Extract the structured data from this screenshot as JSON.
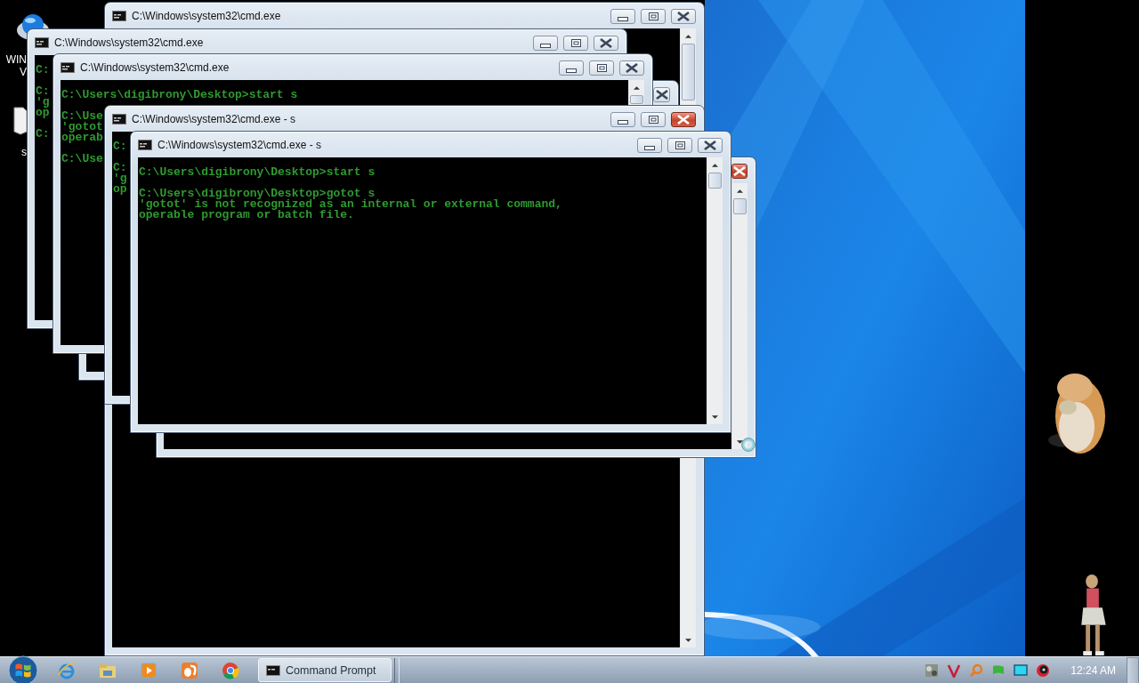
{
  "desktop_icons": [
    {
      "label_lines": [
        "WIN",
        "V"
      ]
    },
    {
      "label_lines": [
        "s"
      ]
    }
  ],
  "windows": [
    {
      "title": "C:\\Windows\\system32\\cmd.exe",
      "controls": [
        {
          "kind": "minimize"
        },
        {
          "kind": "maximize"
        },
        {
          "kind": "close"
        }
      ],
      "close_highlighted": false,
      "scrollbar": [
        {
          "kind": "up"
        },
        {
          "kind": "thumb"
        },
        {
          "kind": "down"
        }
      ]
    },
    {
      "title": "C:\\Windows\\system32\\cmd.exe",
      "controls": [
        {
          "kind": "minimize"
        },
        {
          "kind": "maximize"
        },
        {
          "kind": "close"
        }
      ],
      "close_highlighted": false,
      "output": [
        [
          "C:"
        ],
        [
          "C:",
          "'g",
          "op"
        ],
        [
          "C:"
        ]
      ]
    },
    {
      "controls": [
        {
          "kind": "close"
        }
      ],
      "close_highlighted": false
    },
    {
      "title": "C:\\Windows\\system32\\cmd.exe",
      "controls": [
        {
          "kind": "minimize"
        },
        {
          "kind": "maximize"
        },
        {
          "kind": "close"
        }
      ],
      "close_highlighted": false,
      "scrollbar": [
        {
          "kind": "up"
        },
        {
          "kind": "thumb"
        }
      ],
      "output": [
        [
          "C:\\Users\\digibrony\\Desktop>start s"
        ],
        [
          "C:\\Use",
          "'gotot",
          "operab"
        ],
        [
          "C:\\Use"
        ]
      ]
    },
    {
      "title": "C:\\Windows\\system32\\cmd.exe - s",
      "controls": [
        {
          "kind": "minimize"
        },
        {
          "kind": "maximize"
        },
        {
          "kind": "close"
        }
      ],
      "close_highlighted": true,
      "output": [
        [
          "C:"
        ],
        [
          "C:",
          "'g",
          "op"
        ]
      ]
    },
    {
      "controls": [
        {
          "kind": "close"
        }
      ],
      "close_highlighted": true,
      "scrollbar": [
        {
          "kind": "up"
        },
        {
          "kind": "thumb"
        },
        {
          "kind": "down"
        }
      ]
    },
    {
      "title": "C:\\Windows\\system32\\cmd.exe - s",
      "controls": [
        {
          "kind": "minimize"
        },
        {
          "kind": "maximize"
        },
        {
          "kind": "close"
        }
      ],
      "close_highlighted": false,
      "scrollbar": [
        {
          "kind": "up"
        },
        {
          "kind": "thumb"
        },
        {
          "kind": "down"
        }
      ],
      "output": [
        [
          "C:\\Users\\digibrony\\Desktop>start s"
        ],
        [
          "C:\\Users\\digibrony\\Desktop>gotot s",
          "'gotot' is not recognized as an internal or external command,",
          "operable program or batch file."
        ]
      ]
    }
  ],
  "taskbar": {
    "buttons": [
      {
        "label": "Command Prompt",
        "selected": true
      }
    ],
    "clock": "12:24 AM"
  }
}
